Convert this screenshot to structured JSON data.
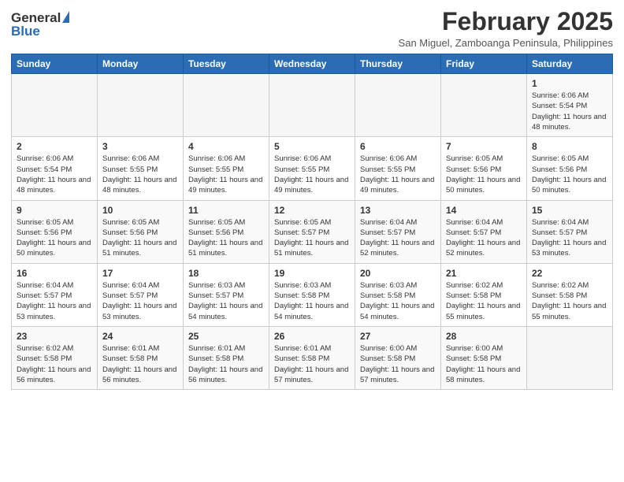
{
  "logo": {
    "general": "General",
    "blue": "Blue"
  },
  "title": "February 2025",
  "subtitle": "San Miguel, Zamboanga Peninsula, Philippines",
  "days_of_week": [
    "Sunday",
    "Monday",
    "Tuesday",
    "Wednesday",
    "Thursday",
    "Friday",
    "Saturday"
  ],
  "weeks": [
    [
      {
        "day": "",
        "sunrise": "",
        "sunset": "",
        "daylight": ""
      },
      {
        "day": "",
        "sunrise": "",
        "sunset": "",
        "daylight": ""
      },
      {
        "day": "",
        "sunrise": "",
        "sunset": "",
        "daylight": ""
      },
      {
        "day": "",
        "sunrise": "",
        "sunset": "",
        "daylight": ""
      },
      {
        "day": "",
        "sunrise": "",
        "sunset": "",
        "daylight": ""
      },
      {
        "day": "",
        "sunrise": "",
        "sunset": "",
        "daylight": ""
      },
      {
        "day": "1",
        "sunrise": "Sunrise: 6:06 AM",
        "sunset": "Sunset: 5:54 PM",
        "daylight": "Daylight: 11 hours and 48 minutes."
      }
    ],
    [
      {
        "day": "2",
        "sunrise": "Sunrise: 6:06 AM",
        "sunset": "Sunset: 5:54 PM",
        "daylight": "Daylight: 11 hours and 48 minutes."
      },
      {
        "day": "3",
        "sunrise": "Sunrise: 6:06 AM",
        "sunset": "Sunset: 5:55 PM",
        "daylight": "Daylight: 11 hours and 48 minutes."
      },
      {
        "day": "4",
        "sunrise": "Sunrise: 6:06 AM",
        "sunset": "Sunset: 5:55 PM",
        "daylight": "Daylight: 11 hours and 49 minutes."
      },
      {
        "day": "5",
        "sunrise": "Sunrise: 6:06 AM",
        "sunset": "Sunset: 5:55 PM",
        "daylight": "Daylight: 11 hours and 49 minutes."
      },
      {
        "day": "6",
        "sunrise": "Sunrise: 6:06 AM",
        "sunset": "Sunset: 5:55 PM",
        "daylight": "Daylight: 11 hours and 49 minutes."
      },
      {
        "day": "7",
        "sunrise": "Sunrise: 6:05 AM",
        "sunset": "Sunset: 5:56 PM",
        "daylight": "Daylight: 11 hours and 50 minutes."
      },
      {
        "day": "8",
        "sunrise": "Sunrise: 6:05 AM",
        "sunset": "Sunset: 5:56 PM",
        "daylight": "Daylight: 11 hours and 50 minutes."
      }
    ],
    [
      {
        "day": "9",
        "sunrise": "Sunrise: 6:05 AM",
        "sunset": "Sunset: 5:56 PM",
        "daylight": "Daylight: 11 hours and 50 minutes."
      },
      {
        "day": "10",
        "sunrise": "Sunrise: 6:05 AM",
        "sunset": "Sunset: 5:56 PM",
        "daylight": "Daylight: 11 hours and 51 minutes."
      },
      {
        "day": "11",
        "sunrise": "Sunrise: 6:05 AM",
        "sunset": "Sunset: 5:56 PM",
        "daylight": "Daylight: 11 hours and 51 minutes."
      },
      {
        "day": "12",
        "sunrise": "Sunrise: 6:05 AM",
        "sunset": "Sunset: 5:57 PM",
        "daylight": "Daylight: 11 hours and 51 minutes."
      },
      {
        "day": "13",
        "sunrise": "Sunrise: 6:04 AM",
        "sunset": "Sunset: 5:57 PM",
        "daylight": "Daylight: 11 hours and 52 minutes."
      },
      {
        "day": "14",
        "sunrise": "Sunrise: 6:04 AM",
        "sunset": "Sunset: 5:57 PM",
        "daylight": "Daylight: 11 hours and 52 minutes."
      },
      {
        "day": "15",
        "sunrise": "Sunrise: 6:04 AM",
        "sunset": "Sunset: 5:57 PM",
        "daylight": "Daylight: 11 hours and 53 minutes."
      }
    ],
    [
      {
        "day": "16",
        "sunrise": "Sunrise: 6:04 AM",
        "sunset": "Sunset: 5:57 PM",
        "daylight": "Daylight: 11 hours and 53 minutes."
      },
      {
        "day": "17",
        "sunrise": "Sunrise: 6:04 AM",
        "sunset": "Sunset: 5:57 PM",
        "daylight": "Daylight: 11 hours and 53 minutes."
      },
      {
        "day": "18",
        "sunrise": "Sunrise: 6:03 AM",
        "sunset": "Sunset: 5:57 PM",
        "daylight": "Daylight: 11 hours and 54 minutes."
      },
      {
        "day": "19",
        "sunrise": "Sunrise: 6:03 AM",
        "sunset": "Sunset: 5:58 PM",
        "daylight": "Daylight: 11 hours and 54 minutes."
      },
      {
        "day": "20",
        "sunrise": "Sunrise: 6:03 AM",
        "sunset": "Sunset: 5:58 PM",
        "daylight": "Daylight: 11 hours and 54 minutes."
      },
      {
        "day": "21",
        "sunrise": "Sunrise: 6:02 AM",
        "sunset": "Sunset: 5:58 PM",
        "daylight": "Daylight: 11 hours and 55 minutes."
      },
      {
        "day": "22",
        "sunrise": "Sunrise: 6:02 AM",
        "sunset": "Sunset: 5:58 PM",
        "daylight": "Daylight: 11 hours and 55 minutes."
      }
    ],
    [
      {
        "day": "23",
        "sunrise": "Sunrise: 6:02 AM",
        "sunset": "Sunset: 5:58 PM",
        "daylight": "Daylight: 11 hours and 56 minutes."
      },
      {
        "day": "24",
        "sunrise": "Sunrise: 6:01 AM",
        "sunset": "Sunset: 5:58 PM",
        "daylight": "Daylight: 11 hours and 56 minutes."
      },
      {
        "day": "25",
        "sunrise": "Sunrise: 6:01 AM",
        "sunset": "Sunset: 5:58 PM",
        "daylight": "Daylight: 11 hours and 56 minutes."
      },
      {
        "day": "26",
        "sunrise": "Sunrise: 6:01 AM",
        "sunset": "Sunset: 5:58 PM",
        "daylight": "Daylight: 11 hours and 57 minutes."
      },
      {
        "day": "27",
        "sunrise": "Sunrise: 6:00 AM",
        "sunset": "Sunset: 5:58 PM",
        "daylight": "Daylight: 11 hours and 57 minutes."
      },
      {
        "day": "28",
        "sunrise": "Sunrise: 6:00 AM",
        "sunset": "Sunset: 5:58 PM",
        "daylight": "Daylight: 11 hours and 58 minutes."
      },
      {
        "day": "",
        "sunrise": "",
        "sunset": "",
        "daylight": ""
      }
    ]
  ]
}
